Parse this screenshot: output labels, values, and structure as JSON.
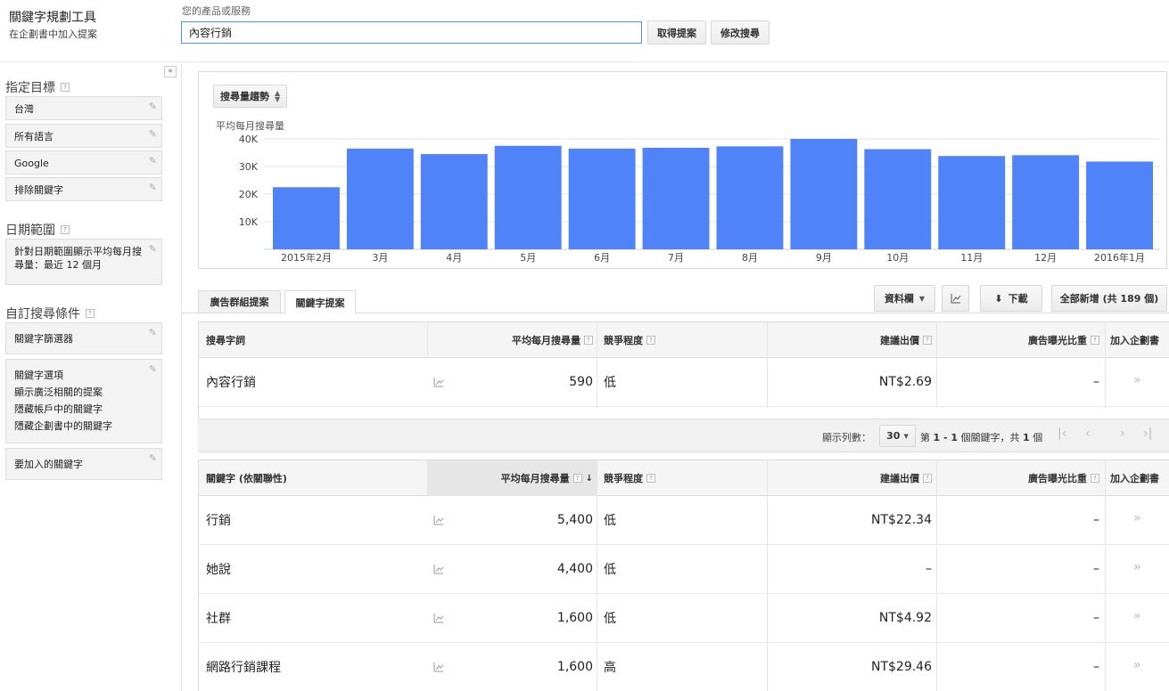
{
  "header": {
    "title": "關鍵字規劃工具",
    "subtitle": "在企劃書中加入提案",
    "product_label": "您的產品或服務",
    "search_value": "內容行銷",
    "get_ideas_label": "取得提案",
    "modify_search_label": "修改搜尋"
  },
  "sidebar": {
    "collapse_label": "«",
    "targeting_heading": "指定目標",
    "targeting_items": [
      "台灣",
      "所有語言",
      "Google",
      "排除關鍵字"
    ],
    "date_heading": "日期範圍",
    "date_text": "針對日期範圍顯示平均每月搜尋量：最近 12 個月",
    "custom_heading": "自訂搜尋條件",
    "keyword_filter": "關鍵字篩選器",
    "keyword_options": {
      "title": "關鍵字選項",
      "lines": [
        "顯示廣泛相關的提案",
        "隱藏帳戶中的關鍵字",
        "隱藏企劃書中的關鍵字"
      ]
    },
    "keywords_to_include": "要加入的關鍵字"
  },
  "chart": {
    "dropdown_label": "搜尋量趨勢",
    "ylabel": "平均每月搜尋量"
  },
  "chart_data": {
    "type": "bar",
    "ylabel": "平均每月搜尋量",
    "categories": [
      "2015年2月",
      "3月",
      "4月",
      "5月",
      "6月",
      "7月",
      "8月",
      "9月",
      "10月",
      "11月",
      "12月",
      "2016年1月"
    ],
    "values": [
      22500,
      36500,
      34500,
      37500,
      36500,
      36800,
      37300,
      40000,
      36300,
      33800,
      34100,
      31800
    ],
    "ylim": [
      0,
      40000
    ],
    "yticks": [
      10000,
      20000,
      30000,
      40000
    ],
    "ytick_labels": [
      "10K",
      "20K",
      "30K",
      "40K"
    ],
    "bar_color": "#5083f7",
    "grid": true,
    "legend": "none"
  },
  "tabs": {
    "ad_groups": "廣告群組提案",
    "keywords": "關鍵字提案"
  },
  "toolbar": {
    "columns": "資料欄",
    "download": "下載",
    "add_all": "全部新增 (共 189 個)"
  },
  "search_terms_table": {
    "headers": {
      "term": "搜尋字詞",
      "avg": "平均每月搜尋量",
      "competition": "競爭程度",
      "bid": "建議出價",
      "impr": "廣告曝光比重",
      "add": "加入企劃書"
    },
    "rows": [
      {
        "keyword": "內容行銷",
        "avg": "590",
        "competition": "低",
        "bid": "NT$2.69",
        "impr": "–"
      }
    ]
  },
  "pager": {
    "rows_label": "顯示列數：",
    "rows_value": "30",
    "page_info_pre": "第 ",
    "page_range": "1 - 1",
    "page_info_mid": " 個關鍵字，共 ",
    "page_total": "1",
    "page_info_post": " 個"
  },
  "ideas_table": {
    "headers": {
      "term": "關鍵字 (依關聯性)",
      "avg": "平均每月搜尋量",
      "competition": "競爭程度",
      "bid": "建議出價",
      "impr": "廣告曝光比重",
      "add": "加入企劃書"
    },
    "rows": [
      {
        "keyword": "行銷",
        "avg": "5,400",
        "competition": "低",
        "bid": "NT$22.34",
        "impr": "–"
      },
      {
        "keyword": "她說",
        "avg": "4,400",
        "competition": "低",
        "bid": "–",
        "impr": "–"
      },
      {
        "keyword": "社群",
        "avg": "1,600",
        "competition": "低",
        "bid": "NT$4.92",
        "impr": "–"
      },
      {
        "keyword": "網路行銷課程",
        "avg": "1,600",
        "competition": "高",
        "bid": "NT$29.46",
        "impr": "–"
      }
    ]
  }
}
